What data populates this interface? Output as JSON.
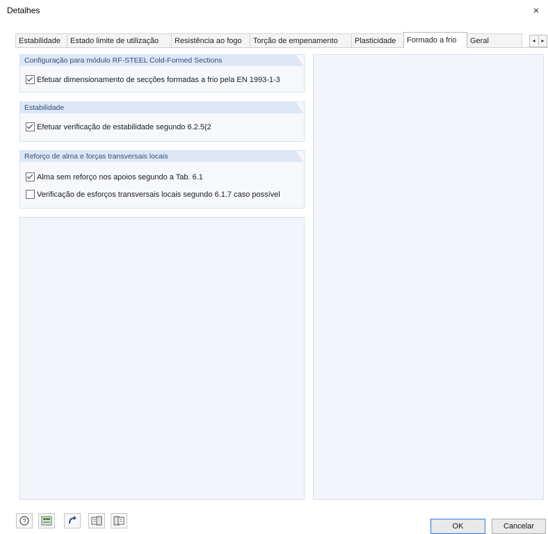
{
  "window": {
    "title": "Detalhes",
    "close_glyph": "×"
  },
  "tabs": [
    {
      "label": "Estabilidade"
    },
    {
      "label": "Estado limite de utilização"
    },
    {
      "label": "Resistência ao fogo"
    },
    {
      "label": "Torção de empenamento"
    },
    {
      "label": "Plasticidade"
    },
    {
      "label": "Formado a frio",
      "active": true
    },
    {
      "label": "Geral"
    }
  ],
  "tab_scroll": {
    "left": "◂",
    "right": "▸"
  },
  "groups": {
    "config": {
      "title": "Configuração para módulo RF-STEEL Cold-Formed Sections",
      "options": [
        {
          "label": "Efetuar dimensionamento de secções formadas a frio pela EN 1993-1-3",
          "checked": true
        }
      ]
    },
    "stability": {
      "title": "Estabilidade",
      "options": [
        {
          "label": "Efetuar verificação de estabilidade segundo 6.2.5(2",
          "checked": true
        }
      ]
    },
    "web": {
      "title": "Reforço de alma e forças transversais locais",
      "options": [
        {
          "label": "Alma sem reforço nos apoios segundo a Tab. 6.1",
          "checked": true
        },
        {
          "label": "Verificação de esforços transversais locais segundo 6.1.7 caso possível",
          "checked": false
        }
      ]
    }
  },
  "toolbar_icons": [
    "help-icon",
    "units-icon",
    "reset-icon",
    "import-defaults-icon",
    "export-defaults-icon"
  ],
  "buttons": {
    "ok": "OK",
    "cancel": "Cancelar"
  }
}
